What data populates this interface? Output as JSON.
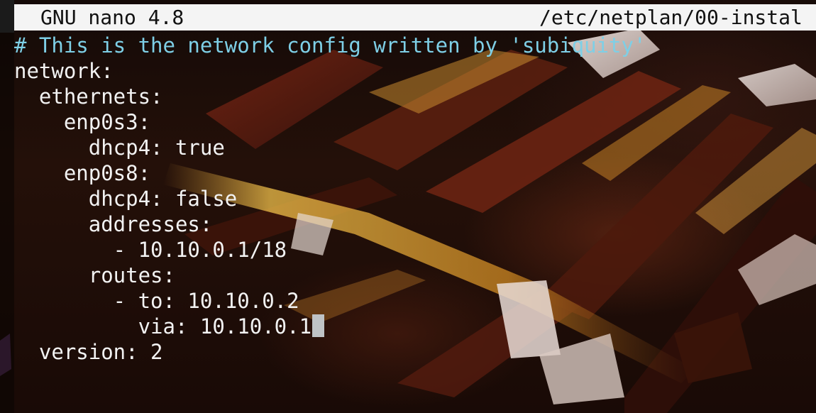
{
  "title_bar": {
    "app": "GNU nano 4.8",
    "file": "/etc/netplan/00-instal"
  },
  "editor": {
    "lines": [
      "# This is the network config written by 'subiquity'",
      "network:",
      "  ethernets:",
      "    enp0s3:",
      "      dhcp4: true",
      "    enp0s8:",
      "      dhcp4: false",
      "      addresses:",
      "        - 10.10.0.1/18",
      "      routes:",
      "        - to: 10.10.0.2",
      "          via: 10.10.0.1",
      "  version: 2"
    ]
  },
  "colors": {
    "comment": "#7ecfe6",
    "text": "#f2f2f2",
    "title_bar_bg": "#f4f4f4",
    "cursor": "#bfc3c6"
  }
}
